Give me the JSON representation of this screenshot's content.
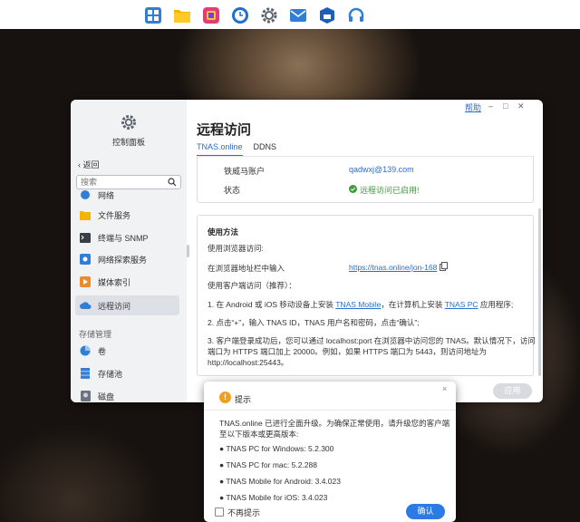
{
  "dock": {
    "icons": [
      "app-switcher-icon",
      "folder-icon",
      "photo-app-icon",
      "backup-clock-icon",
      "gear-icon",
      "mail-icon",
      "store-icon",
      "headset-icon"
    ]
  },
  "window": {
    "help": "帮助",
    "min": "–",
    "max": "□",
    "close": "✕"
  },
  "sidebar": {
    "title": "控制面板",
    "back": "返回",
    "search_placeholder": "搜索",
    "items": [
      {
        "label": "网络"
      },
      {
        "label": "文件服务"
      },
      {
        "label": "终端与 SNMP"
      },
      {
        "label": "网络探索服务"
      },
      {
        "label": "媒体索引"
      },
      {
        "label": "远程访问"
      }
    ],
    "section": "存储管理",
    "storage_items": [
      {
        "label": "卷"
      },
      {
        "label": "存储池"
      },
      {
        "label": "磁盘"
      }
    ]
  },
  "main": {
    "title": "远程访问",
    "tabs": [
      {
        "label": "TNAS.online"
      },
      {
        "label": "DDNS"
      }
    ],
    "account_label": "铁威马账户",
    "account_value": "qadwxj@139.com",
    "status_label": "状态",
    "status_value": "远程访问已启用!",
    "usage": {
      "heading": "使用方法",
      "browser_title": "使用浏览器访问:",
      "browser_line": "在浏览器地址栏中输入",
      "browser_url": "https://tnas.online/jon-168",
      "client_title": "使用客户端访问（推荐）：",
      "step1_a": "1. 在 Android 或 iOS 移动设备上安装 ",
      "step1_link1": "TNAS Mobile",
      "step1_b": "，在计算机上安装 ",
      "step1_link2": "TNAS PC",
      "step1_c": " 应用程序;",
      "step2": "2. 点击“+”，输入 TNAS ID，TNAS 用户名和密码，点击“确认”;",
      "step3_l1": "3. 客户端登录成功后，您可以通过 localhost:port 在浏览器中访问您的 TNAS。默认情况下，访问",
      "step3_l2": "端口为 HTTPS 端口加上 20000。例如，如果 HTTPS 端口为 5443，则访问地址为",
      "step3_l3": "http://localhost:25443。"
    },
    "apply": "应用"
  },
  "dialog": {
    "title": "提示",
    "icon": "!",
    "close": "×",
    "intro_l1": "TNAS.online 已进行全面升级。为确保正常使用，请升级您的客户端",
    "intro_l2": "至以下版本或更高版本:",
    "versions": [
      "● TNAS PC for Windows: 5.2.300",
      "● TNAS PC for mac: 5.2.288",
      "● TNAS Mobile for Android: 3.4.023",
      "● TNAS Mobile for iOS: 3.4.023"
    ],
    "dont_show": "不再提示",
    "confirm": "确认"
  }
}
